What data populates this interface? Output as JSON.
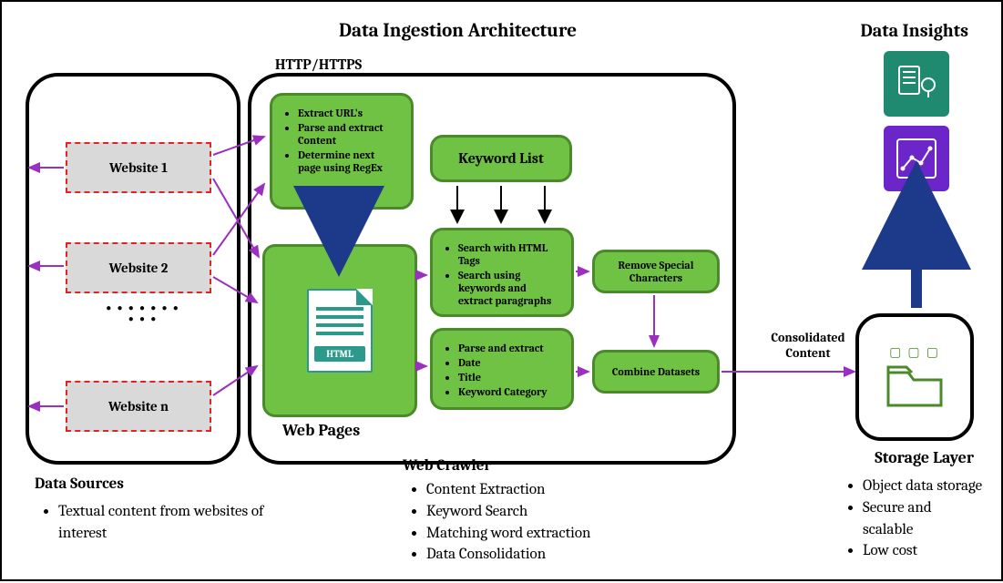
{
  "titles": {
    "main": "Data Ingestion Architecture",
    "insights": "Data Insights",
    "http": "HTTP/HTTPS"
  },
  "websites": {
    "w1": "Website 1",
    "w2": "Website 2",
    "w3": "Website n"
  },
  "boxes": {
    "extract": [
      "Extract URL's",
      "Parse and extract Content",
      "Determine next page using RegEx"
    ],
    "keyword_list": "Keyword List",
    "search": [
      "Search with HTML Tags",
      "Search using keywords and extract paragraphs"
    ],
    "parse": [
      "Parse and extract",
      "Date",
      "Title",
      "Keyword Category"
    ],
    "remove": "Remove Special Characters",
    "combine": "Combine Datasets",
    "webpages_tag": "HTML",
    "webpages_label": "Web Pages"
  },
  "labels": {
    "consolidated": "Consolidated Content",
    "storage": "Storage Layer",
    "data_sources": "Data Sources",
    "web_crawler": "Web Crawler"
  },
  "lists": {
    "data_sources": [
      "Textual content from websites of interest"
    ],
    "web_crawler": [
      "Content Extraction",
      "Keyword Search",
      "Matching word extraction",
      "Data Consolidation"
    ],
    "storage": [
      "Object data storage",
      "Secure and scalable",
      "Low cost"
    ]
  },
  "colors": {
    "green": "#70c244",
    "green_border": "#4b8a2a",
    "purple": "#9b2fbf",
    "red_dash": "#dc2626",
    "navy": "#1d3a8a",
    "teal": "#1f8a70",
    "violet": "#6b25c9"
  }
}
